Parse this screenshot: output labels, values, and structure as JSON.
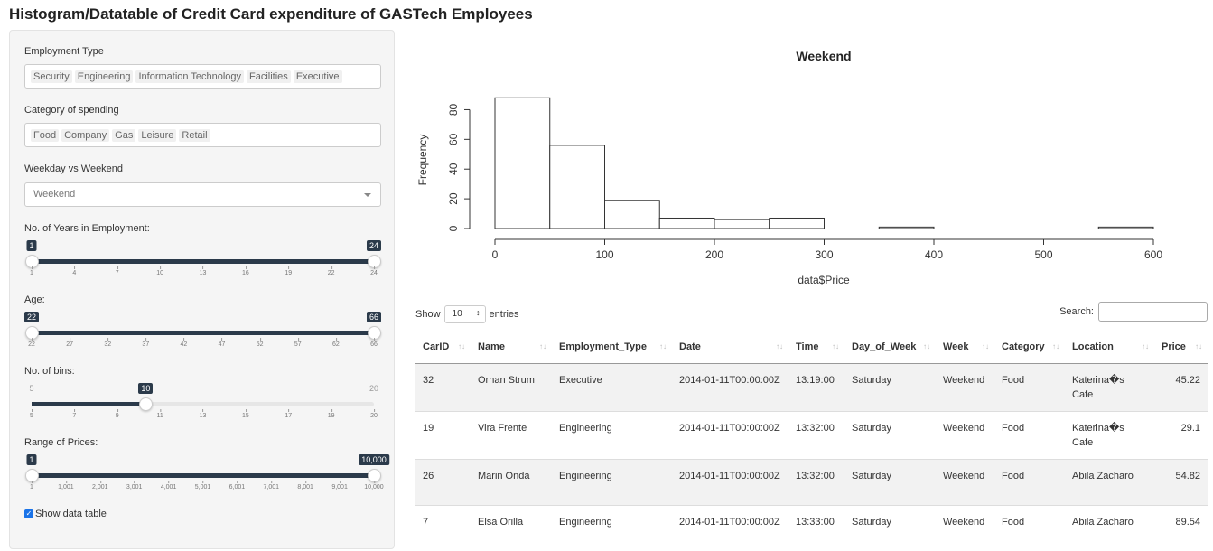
{
  "page_title": "Histogram/Datatable of Credit Card expenditure of GASTech Employees",
  "sidebar": {
    "employment_type": {
      "label": "Employment Type",
      "chips": [
        "Security",
        "Engineering",
        "Information Technology",
        "Facilities",
        "Executive"
      ]
    },
    "category": {
      "label": "Category of spending",
      "chips": [
        "Food",
        "Company",
        "Gas",
        "Leisure",
        "Retail"
      ]
    },
    "weekday": {
      "label": "Weekday vs Weekend",
      "value": "Weekend"
    },
    "years": {
      "label": "No. of Years in Employment:",
      "min": 1,
      "max": 24,
      "from": 1,
      "to": 24,
      "ticks": [
        "1",
        "4",
        "7",
        "10",
        "13",
        "16",
        "19",
        "22",
        "24"
      ]
    },
    "age": {
      "label": "Age:",
      "min": 22,
      "max": 66,
      "from": 22,
      "to": 66,
      "ticks": [
        "22",
        "27",
        "32",
        "37",
        "42",
        "47",
        "52",
        "57",
        "62",
        "66"
      ]
    },
    "bins": {
      "label": "No. of bins:",
      "min": 5,
      "max": 20,
      "value": 10,
      "min_label": "5",
      "max_label": "20",
      "value_label": "10",
      "ticks": [
        "5",
        "7",
        "9",
        "11",
        "13",
        "15",
        "17",
        "19",
        "20"
      ]
    },
    "prices": {
      "label": "Range of Prices:",
      "min": 1,
      "max": 10000,
      "from": 1,
      "to": 10000,
      "from_label": "1",
      "to_label": "10,000",
      "ticks": [
        "1",
        "1,001",
        "2,001",
        "3,001",
        "4,001",
        "5,001",
        "6,001",
        "7,001",
        "8,001",
        "9,001",
        "10,000"
      ]
    },
    "show_table": {
      "label": "Show data table",
      "checked": true
    }
  },
  "chart_data": {
    "type": "bar",
    "title": "Weekend",
    "xlabel": "data$Price",
    "ylabel": "Frequency",
    "bin_edges": [
      0,
      50,
      100,
      150,
      200,
      250,
      300,
      350,
      400,
      450,
      500,
      550,
      600
    ],
    "values": [
      88,
      56,
      19,
      7,
      6,
      7,
      0,
      1,
      0,
      0,
      0,
      1
    ],
    "xlim": [
      0,
      600
    ],
    "ylim": [
      0,
      90
    ],
    "xticks": [
      "0",
      "100",
      "200",
      "300",
      "400",
      "500",
      "600"
    ],
    "yticks": [
      "0",
      "20",
      "40",
      "60",
      "80"
    ]
  },
  "table": {
    "show_label": "Show",
    "length_value": "10",
    "entries_label": "entries",
    "search_label": "Search:",
    "columns": [
      "CarID",
      "Name",
      "Employment_Type",
      "Date",
      "Time",
      "Day_of_Week",
      "Week",
      "Category",
      "Location",
      "Price"
    ],
    "rows": [
      [
        "32",
        "Orhan Strum",
        "Executive",
        "2014-01-11T00:00:00Z",
        "13:19:00",
        "Saturday",
        "Weekend",
        "Food",
        "Katerina�s Cafe",
        "45.22"
      ],
      [
        "19",
        "Vira Frente",
        "Engineering",
        "2014-01-11T00:00:00Z",
        "13:32:00",
        "Saturday",
        "Weekend",
        "Food",
        "Katerina�s Cafe",
        "29.1"
      ],
      [
        "26",
        "Marin Onda",
        "Engineering",
        "2014-01-11T00:00:00Z",
        "13:32:00",
        "Saturday",
        "Weekend",
        "Food",
        "Abila Zacharo",
        "54.82"
      ],
      [
        "7",
        "Elsa Orilla",
        "Engineering",
        "2014-01-11T00:00:00Z",
        "13:33:00",
        "Saturday",
        "Weekend",
        "Food",
        "Abila Zacharo",
        "89.54"
      ]
    ]
  },
  "colors": {
    "slider": "#2b3a4a",
    "row_stripe": "#f2f2f2",
    "checkbox": "#1a73e8"
  }
}
